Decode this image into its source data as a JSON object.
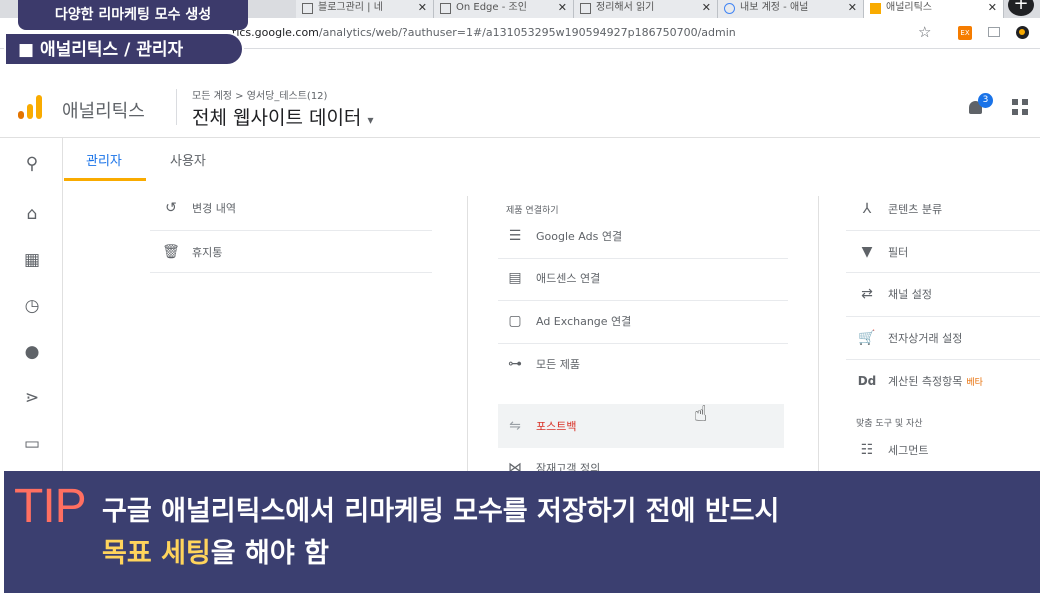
{
  "browser": {
    "tabs": [
      {
        "label": "블로그관리 | 네"
      },
      {
        "label": "On Edge - 조인"
      },
      {
        "label": "정리해서 읽기"
      },
      {
        "label": "내보 계정 - 애널"
      },
      {
        "label": "애널리틱스"
      }
    ],
    "url_prefix": "tics.google.com",
    "url_rest": "/analytics/web/?authuser=1#/a131053295w190594927p186750700/admin"
  },
  "captions": {
    "top_label": "다양한 리마케팅 모수 생성",
    "section_label": "■  애널리틱스 / 관리자"
  },
  "header": {
    "app_name": "애널리틱스",
    "breadcrumb": "모든 계정 > 영서당_테스트(12)",
    "view_name": "전체 웹사이트 데이터",
    "notification_count": "3"
  },
  "tabs": {
    "admin": "관리자",
    "user": "사용자"
  },
  "col1": {
    "items": [
      {
        "label": "변경 내역"
      },
      {
        "label": "휴지통"
      }
    ]
  },
  "col2": {
    "section_title": "제품 연결하기",
    "items": [
      {
        "label": "Google Ads 연결"
      },
      {
        "label": "애드센스 연결"
      },
      {
        "label": "Ad Exchange 연결"
      },
      {
        "label": "모든 제품"
      }
    ],
    "postback": "포스트백",
    "partial_item": "잠재고객 정의"
  },
  "col3": {
    "items": [
      {
        "label": "콘텐츠 분류"
      },
      {
        "label": "필터"
      },
      {
        "label": "채널 설정"
      },
      {
        "label": "전자상거래 설정"
      },
      {
        "label": "계산된 측정항목",
        "badge": "베타"
      }
    ],
    "section_title": "맞춤 도구 및 자산",
    "segment": "세그먼트",
    "calc_icon_text": "Dd"
  },
  "tip": {
    "word": "TIP",
    "line1": "구글 애널리틱스에서 리마케팅 모수를 저장하기 전에 반드시",
    "line2_highlight": "목표 세팅",
    "line2_rest": "을 해야 함"
  },
  "colors": {
    "accent": "#f9ab00",
    "caption_bg": "#3c3a6b",
    "tip_bg": "#3b3f70",
    "tip_red": "#ff6f61",
    "tip_yellow": "#ffd45c",
    "notify_blue": "#1a73e8"
  }
}
